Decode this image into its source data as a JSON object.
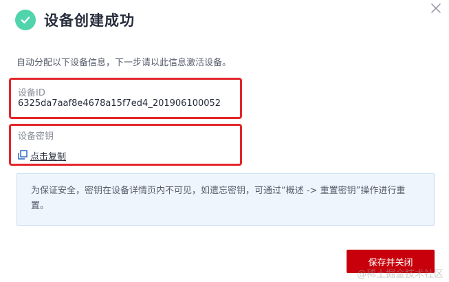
{
  "dialog": {
    "title": "设备创建成功",
    "intro": "自动分配以下设备信息，下一步请以此信息激活设备。",
    "success_icon": "check-circle-icon",
    "close_icon": "close-icon"
  },
  "device_id": {
    "label": "设备ID",
    "value": "6325da7aaf8e4678a15f7ed4_201906100052"
  },
  "device_secret": {
    "label": "设备密钥",
    "copy_label": "点击复制",
    "copy_icon": "copy-icon"
  },
  "notice": {
    "text": "为保证安全，密钥在设备详情页内不可见，如遗忘密钥，可通过“概述 -> 重置密钥”操作进行重置。"
  },
  "footer": {
    "save_close_label": "保存并关闭"
  },
  "watermark": "@稀土掘金技术社区",
  "colors": {
    "success": "#50d4ab",
    "primary_button": "#c7000b",
    "highlight_border": "#e3262b",
    "notice_bg": "#eef5fc",
    "notice_border": "#c5dcf3"
  }
}
